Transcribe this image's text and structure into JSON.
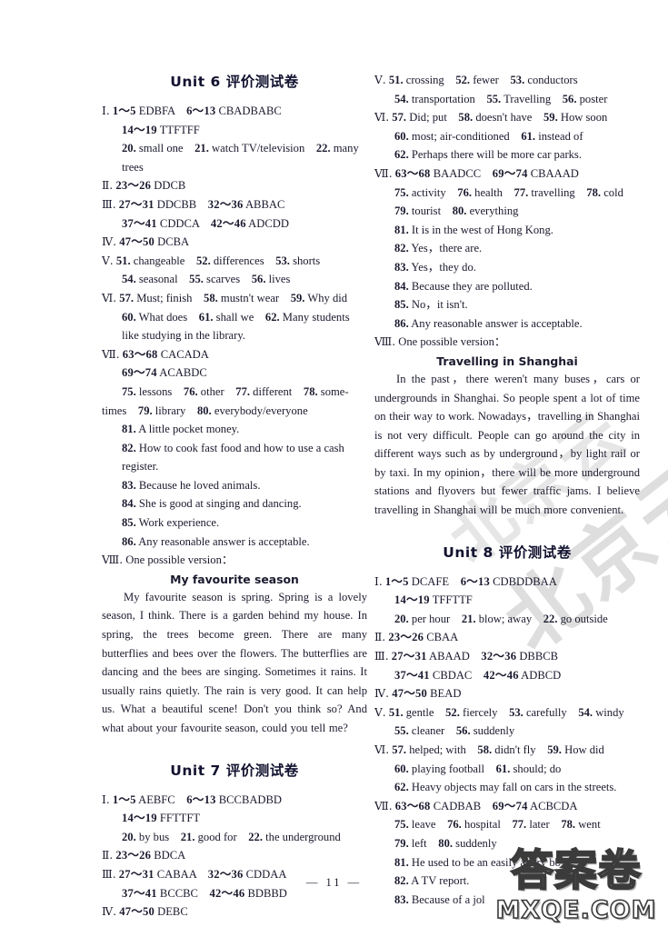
{
  "page": {
    "number": "— 11 —",
    "watermark_diagonal": "北京云",
    "watermark_logo_cn": "答案卷",
    "watermark_logo_url": "MXQE.COM"
  },
  "left_column": {
    "unit6": {
      "title": "Unit 6 评价测试卷",
      "lines": [
        {
          "roman": "Ⅰ",
          "text": "1～5 EDBFA　6～13 CBADBABC",
          "indent": "hang"
        },
        {
          "roman": "",
          "text": "14～19 TTFTFF",
          "indent": "cont"
        },
        {
          "roman": "",
          "text": "20. small one　21. watch TV/television　22. many trees",
          "indent": "cont"
        },
        {
          "roman": "Ⅱ",
          "text": "23～26 DDCB",
          "indent": "hang"
        },
        {
          "roman": "Ⅲ",
          "text": "27～31 DDCBB　32～36 ABBAC",
          "indent": "hang"
        },
        {
          "roman": "",
          "text": "37～41 CDDCA　42～46 ADCDD",
          "indent": "cont"
        },
        {
          "roman": "Ⅳ",
          "text": "47～50 DCBA",
          "indent": "hang"
        },
        {
          "roman": "Ⅴ",
          "text": "51. changeable　52. differences　53. shorts",
          "indent": "hang"
        },
        {
          "roman": "",
          "text": "54. seasonal　55. scarves　56. lives",
          "indent": "cont"
        },
        {
          "roman": "Ⅵ",
          "text": "57. Must; finish　58. mustn't wear　59. Why did",
          "indent": "hang"
        },
        {
          "roman": "",
          "text": "60. What does　61. shall we　62. Many students",
          "indent": "cont"
        },
        {
          "roman": "",
          "text": "like studying in the library.",
          "indent": "cont"
        },
        {
          "roman": "Ⅶ",
          "text": "63～68 CACADA",
          "indent": "hang"
        },
        {
          "roman": "",
          "text": "69～74 ACABDC",
          "indent": "cont"
        },
        {
          "roman": "",
          "text": "75. lessons　76. other　77. different　78. some-",
          "indent": "cont"
        },
        {
          "roman": "",
          "text": "times　79. library　80. everybody/everyone",
          "indent": "cont-flush"
        },
        {
          "roman": "",
          "text": "81. A little pocket money.",
          "indent": "cont"
        },
        {
          "roman": "",
          "text": "82. How to cook fast food and how to use a cash",
          "indent": "cont"
        },
        {
          "roman": "",
          "text": "register.",
          "indent": "cont-deep"
        },
        {
          "roman": "",
          "text": "83. Because he loved animals.",
          "indent": "cont"
        },
        {
          "roman": "",
          "text": "84. She is good at singing and dancing.",
          "indent": "cont"
        },
        {
          "roman": "",
          "text": "85. Work experience.",
          "indent": "cont"
        },
        {
          "roman": "",
          "text": "86. Any reasonable answer is acceptable.",
          "indent": "cont"
        },
        {
          "roman": "Ⅷ",
          "text": "One possible version：",
          "indent": "hang"
        }
      ],
      "essay_title": "My favourite season",
      "essay_body": "My favourite season is spring. Spring is a lovely season, I think. There is a garden behind my house. In spring, the trees become green. There are many butterflies and bees over the flowers. The butterflies are dancing and the bees are singing. Sometimes it rains. It usually rains quietly. The rain is very good. It can help us. What a beautiful scene! Don't you think so? And what about your favourite season, could you tell me?"
    },
    "unit7": {
      "title": "Unit 7 评价测试卷",
      "lines": [
        {
          "roman": "Ⅰ",
          "text": "1～5 AEBFC　6～13 BCCBADBD",
          "indent": "hang"
        },
        {
          "roman": "",
          "text": "14～19 FFTTFT",
          "indent": "cont"
        },
        {
          "roman": "",
          "text": "20. by bus　21. good for　22. the underground",
          "indent": "cont"
        },
        {
          "roman": "Ⅱ",
          "text": "23～26 BDCA",
          "indent": "hang"
        },
        {
          "roman": "Ⅲ",
          "text": "27～31 CABAA　32～36 CDDAA",
          "indent": "hang"
        },
        {
          "roman": "",
          "text": "37～41 BCCBC　42～46 BDBBD",
          "indent": "cont"
        },
        {
          "roman": "Ⅳ",
          "text": "47～50 DEBC",
          "indent": "hang"
        }
      ]
    }
  },
  "right_column": {
    "unit7_cont": {
      "lines": [
        {
          "roman": "Ⅴ",
          "text": "51. crossing　52. fewer　53. conductors",
          "indent": "hang"
        },
        {
          "roman": "",
          "text": "54. transportation　55. Travelling　56. poster",
          "indent": "cont"
        },
        {
          "roman": "Ⅵ",
          "text": "57. Did; put　58. doesn't have　59. How soon",
          "indent": "hang"
        },
        {
          "roman": "",
          "text": "60. most; air-conditioned　61. instead of",
          "indent": "cont"
        },
        {
          "roman": "",
          "text": "62. Perhaps there will be more car parks.",
          "indent": "cont"
        },
        {
          "roman": "Ⅶ",
          "text": "63～68 BAADCC　69～74 CBAAAD",
          "indent": "hang"
        },
        {
          "roman": "",
          "text": "75. activity　76. health　77. travelling　78. cold",
          "indent": "cont"
        },
        {
          "roman": "",
          "text": "79. tourist　80. everything",
          "indent": "cont"
        },
        {
          "roman": "",
          "text": "81. It is in the west of Hong Kong.",
          "indent": "cont"
        },
        {
          "roman": "",
          "text": "82. Yes，there are.",
          "indent": "cont"
        },
        {
          "roman": "",
          "text": "83. Yes，they do.",
          "indent": "cont"
        },
        {
          "roman": "",
          "text": "84. Because they are polluted.",
          "indent": "cont"
        },
        {
          "roman": "",
          "text": "85. No，it isn't.",
          "indent": "cont"
        },
        {
          "roman": "",
          "text": "86. Any reasonable answer is acceptable.",
          "indent": "cont"
        },
        {
          "roman": "Ⅷ",
          "text": "One possible version：",
          "indent": "hang"
        }
      ],
      "essay_title": "Travelling in Shanghai",
      "essay_body": "In the past，there weren't many buses，cars or undergrounds in Shanghai. So people spent a lot of time on their way to work. Nowadays，travelling in Shanghai is not very difficult. People can go around the city in different ways such as by underground，by light rail or by taxi. In my opinion，there will be more underground stations and flyovers but fewer traffic jams. I believe travelling in Shanghai will be much more convenient."
    },
    "unit8": {
      "title": "Unit 8 评价测试卷",
      "lines": [
        {
          "roman": "Ⅰ",
          "text": "1～5 DCAFE　6～13 CDBDDBAA",
          "indent": "hang"
        },
        {
          "roman": "",
          "text": "14～19 TFFTTF",
          "indent": "cont"
        },
        {
          "roman": "",
          "text": "20. per hour　21. blow; away　22. go outside",
          "indent": "cont"
        },
        {
          "roman": "Ⅱ",
          "text": "23～26 CBAA",
          "indent": "hang"
        },
        {
          "roman": "Ⅲ",
          "text": "27～31 ABAAD　32～36 DBBCB",
          "indent": "hang"
        },
        {
          "roman": "",
          "text": "37～41 CBDAC　42～46 ADBCD",
          "indent": "cont"
        },
        {
          "roman": "Ⅳ",
          "text": "47～50 BEAD",
          "indent": "hang"
        },
        {
          "roman": "Ⅴ",
          "text": "51. gentle　52. fiercely　53. carefully　54. windy",
          "indent": "hang"
        },
        {
          "roman": "",
          "text": "55. cleaner　56. suddenly",
          "indent": "cont"
        },
        {
          "roman": "Ⅵ",
          "text": "57. helped; with　58. didn't fly　59. How did",
          "indent": "hang"
        },
        {
          "roman": "",
          "text": "60. playing football　61. should; do",
          "indent": "cont"
        },
        {
          "roman": "",
          "text": "62. Heavy objects may fall on cars in the streets.",
          "indent": "cont"
        },
        {
          "roman": "Ⅶ",
          "text": "63～68 CADBAB　69～74 ACBCDA",
          "indent": "hang"
        },
        {
          "roman": "",
          "text": "75. leave　76. hospital　77. later　78. went",
          "indent": "cont"
        },
        {
          "roman": "",
          "text": "79. left　80. suddenly",
          "indent": "cont"
        },
        {
          "roman": "",
          "text": "81. He used to be an easily angry boy.",
          "indent": "cont"
        },
        {
          "roman": "",
          "text": "82. A TV report.",
          "indent": "cont"
        },
        {
          "roman": "",
          "text": "83. Because of a jol",
          "indent": "cont"
        }
      ]
    }
  }
}
